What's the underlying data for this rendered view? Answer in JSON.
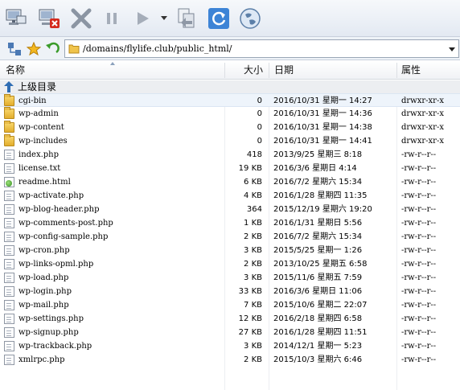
{
  "toolbar": {
    "buttons": [
      "connect-icon",
      "disconnect-icon",
      "stop-icon",
      "pause-icon",
      "play-icon",
      "transfer-icon",
      "refresh-icon",
      "browser-icon"
    ]
  },
  "address_bar": {
    "path": "/domains/flylife.club/public_html/"
  },
  "columns": {
    "name": "名称",
    "size": "大小",
    "date": "日期",
    "attributes": "属性"
  },
  "parent_directory_label": "上级目录",
  "files": [
    {
      "name": "cgi-bin",
      "type": "folder",
      "size": "0",
      "date": "2016/10/31 星期一 14:27",
      "attr": "drwxr-xr-x"
    },
    {
      "name": "wp-admin",
      "type": "folder",
      "size": "0",
      "date": "2016/10/31 星期一 14:36",
      "attr": "drwxr-xr-x"
    },
    {
      "name": "wp-content",
      "type": "folder",
      "size": "0",
      "date": "2016/10/31 星期一 14:38",
      "attr": "drwxr-xr-x"
    },
    {
      "name": "wp-includes",
      "type": "folder",
      "size": "0",
      "date": "2016/10/31 星期一 14:41",
      "attr": "drwxr-xr-x"
    },
    {
      "name": "index.php",
      "type": "file",
      "size": "418",
      "date": "2013/9/25 星期三 8:18",
      "attr": "-rw-r--r--"
    },
    {
      "name": "license.txt",
      "type": "file",
      "size": "19 KB",
      "date": "2016/3/6 星期日 4:14",
      "attr": "-rw-r--r--"
    },
    {
      "name": "readme.html",
      "type": "html",
      "size": "6 KB",
      "date": "2016/7/2 星期六 15:34",
      "attr": "-rw-r--r--"
    },
    {
      "name": "wp-activate.php",
      "type": "file",
      "size": "4 KB",
      "date": "2016/1/28 星期四 11:35",
      "attr": "-rw-r--r--"
    },
    {
      "name": "wp-blog-header.php",
      "type": "file",
      "size": "364",
      "date": "2015/12/19 星期六 19:20",
      "attr": "-rw-r--r--"
    },
    {
      "name": "wp-comments-post.php",
      "type": "file",
      "size": "1 KB",
      "date": "2016/1/31 星期日 5:56",
      "attr": "-rw-r--r--"
    },
    {
      "name": "wp-config-sample.php",
      "type": "file",
      "size": "2 KB",
      "date": "2016/7/2 星期六 15:34",
      "attr": "-rw-r--r--"
    },
    {
      "name": "wp-cron.php",
      "type": "file",
      "size": "3 KB",
      "date": "2015/5/25 星期一 1:26",
      "attr": "-rw-r--r--"
    },
    {
      "name": "wp-links-opml.php",
      "type": "file",
      "size": "2 KB",
      "date": "2013/10/25 星期五 6:58",
      "attr": "-rw-r--r--"
    },
    {
      "name": "wp-load.php",
      "type": "file",
      "size": "3 KB",
      "date": "2015/11/6 星期五 7:59",
      "attr": "-rw-r--r--"
    },
    {
      "name": "wp-login.php",
      "type": "file",
      "size": "33 KB",
      "date": "2016/3/6 星期日 11:06",
      "attr": "-rw-r--r--"
    },
    {
      "name": "wp-mail.php",
      "type": "file",
      "size": "7 KB",
      "date": "2015/10/6 星期二 22:07",
      "attr": "-rw-r--r--"
    },
    {
      "name": "wp-settings.php",
      "type": "file",
      "size": "12 KB",
      "date": "2016/2/18 星期四 6:58",
      "attr": "-rw-r--r--"
    },
    {
      "name": "wp-signup.php",
      "type": "file",
      "size": "27 KB",
      "date": "2016/1/28 星期四 11:51",
      "attr": "-rw-r--r--"
    },
    {
      "name": "wp-trackback.php",
      "type": "file",
      "size": "3 KB",
      "date": "2014/12/1 星期一 5:23",
      "attr": "-rw-r--r--"
    },
    {
      "name": "xmlrpc.php",
      "type": "file",
      "size": "2 KB",
      "date": "2015/10/3 星期六 6:46",
      "attr": "-rw-r--r--"
    }
  ]
}
